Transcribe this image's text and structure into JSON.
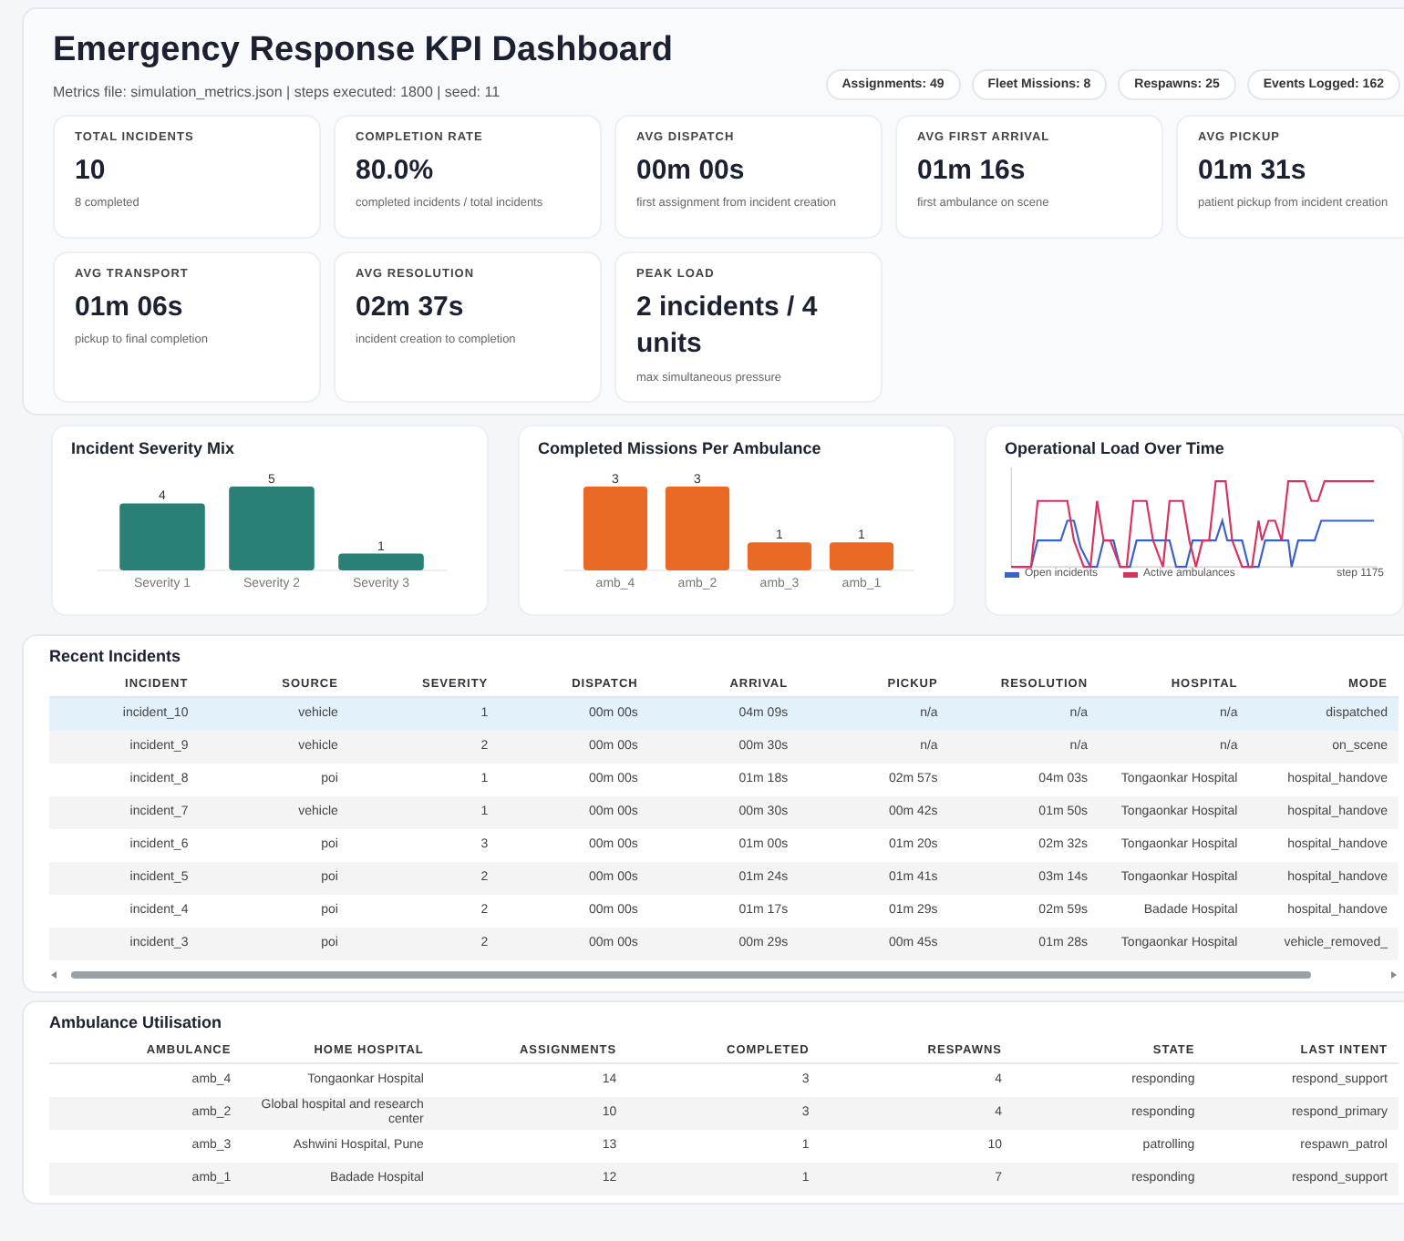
{
  "header": {
    "title": "Emergency Response KPI Dashboard",
    "subtitle": "Metrics file: simulation_metrics.json | steps executed: 1800 | seed: 11",
    "pills": [
      "Assignments: 49",
      "Fleet Missions: 8",
      "Respawns: 25",
      "Events Logged: 162"
    ]
  },
  "kpis": [
    {
      "label": "TOTAL INCIDENTS",
      "value": "10",
      "note": "8 completed"
    },
    {
      "label": "COMPLETION RATE",
      "value": "80.0%",
      "note": "completed incidents / total incidents"
    },
    {
      "label": "AVG DISPATCH",
      "value": "00m 00s",
      "note": "first assignment from incident creation"
    },
    {
      "label": "AVG FIRST ARRIVAL",
      "value": "01m 16s",
      "note": "first ambulance on scene"
    },
    {
      "label": "AVG PICKUP",
      "value": "01m 31s",
      "note": "patient pickup from incident creation"
    },
    {
      "label": "AVG TRANSPORT",
      "value": "01m 06s",
      "note": "pickup to final completion"
    },
    {
      "label": "AVG RESOLUTION",
      "value": "02m 37s",
      "note": "incident creation to completion"
    },
    {
      "label": "PEAK LOAD",
      "value": "2 incidents / 4 units",
      "note": "max simultaneous pressure"
    }
  ],
  "charts": [
    {
      "kind": "bar",
      "chart_data": {
        "type": "bar",
        "title": "Incident Severity Mix",
        "categories": [
          "Severity 1",
          "Severity 2",
          "Severity 3"
        ],
        "series": [
          {
            "color": "#2a8075",
            "values": [
              4,
              5,
              1
            ]
          }
        ],
        "data_labels": true
      }
    },
    {
      "kind": "bar",
      "chart_data": {
        "type": "bar",
        "title": "Completed Missions Per Ambulance",
        "categories": [
          "amb_4",
          "amb_2",
          "amb_3",
          "amb_1"
        ],
        "series": [
          {
            "color": "#e96a25",
            "values": [
              3,
              3,
              1,
              1
            ]
          }
        ],
        "data_labels": true
      }
    },
    {
      "kind": "picture",
      "title": "Operational Load Over Time",
      "legend": [
        {
          "label": "Open incidents",
          "color": "#3a62c9"
        },
        {
          "label": "Active ambulances",
          "color": "#d8325e"
        }
      ],
      "note": "step 1175"
    }
  ],
  "incidents": {
    "title": "Recent Incidents",
    "columns": [
      "INCIDENT",
      "SOURCE",
      "SEVERITY",
      "DISPATCH",
      "ARRIVAL",
      "PICKUP",
      "RESOLUTION",
      "HOSPITAL",
      "MODE"
    ],
    "rows": [
      {
        "selected": true,
        "cells": [
          "incident_10",
          "vehicle",
          "1",
          "00m 00s",
          "04m 09s",
          "n/a",
          "n/a",
          "n/a",
          "dispatched"
        ]
      },
      {
        "selected": false,
        "cells": [
          "incident_9",
          "vehicle",
          "2",
          "00m 00s",
          "00m 30s",
          "n/a",
          "n/a",
          "n/a",
          "on_scene"
        ]
      },
      {
        "selected": false,
        "cells": [
          "incident_8",
          "poi",
          "1",
          "00m 00s",
          "01m 18s",
          "02m 57s",
          "04m 03s",
          "Tongaonkar Hospital",
          "hospital_handove"
        ]
      },
      {
        "selected": false,
        "cells": [
          "incident_7",
          "vehicle",
          "1",
          "00m 00s",
          "00m 30s",
          "00m 42s",
          "01m 50s",
          "Tongaonkar Hospital",
          "hospital_handove"
        ]
      },
      {
        "selected": false,
        "cells": [
          "incident_6",
          "poi",
          "3",
          "00m 00s",
          "01m 00s",
          "01m 20s",
          "02m 32s",
          "Tongaonkar Hospital",
          "hospital_handove"
        ]
      },
      {
        "selected": false,
        "cells": [
          "incident_5",
          "poi",
          "2",
          "00m 00s",
          "01m 24s",
          "01m 41s",
          "03m 14s",
          "Tongaonkar Hospital",
          "hospital_handove"
        ]
      },
      {
        "selected": false,
        "cells": [
          "incident_4",
          "poi",
          "2",
          "00m 00s",
          "01m 17s",
          "01m 29s",
          "02m 59s",
          "Badade Hospital",
          "hospital_handove"
        ]
      },
      {
        "selected": false,
        "cells": [
          "incident_3",
          "poi",
          "2",
          "00m 00s",
          "00m 29s",
          "00m 45s",
          "01m 28s",
          "Tongaonkar Hospital",
          "vehicle_removed_"
        ]
      }
    ]
  },
  "ambulances": {
    "title": "Ambulance Utilisation",
    "columns": [
      "AMBULANCE",
      "HOME HOSPITAL",
      "ASSIGNMENTS",
      "COMPLETED",
      "RESPAWNS",
      "STATE",
      "LAST INTENT"
    ],
    "rows": [
      [
        "amb_4",
        "Tongaonkar Hospital",
        "14",
        "3",
        "4",
        "responding",
        "respond_support"
      ],
      [
        "amb_2",
        "Global hospital and research center",
        "10",
        "3",
        "4",
        "responding",
        "respond_primary"
      ],
      [
        "amb_3",
        "Ashwini Hospital, Pune",
        "13",
        "1",
        "10",
        "patrolling",
        "respawn_patrol"
      ],
      [
        "amb_1",
        "Badade Hospital",
        "12",
        "1",
        "7",
        "responding",
        "respond_support"
      ]
    ]
  }
}
